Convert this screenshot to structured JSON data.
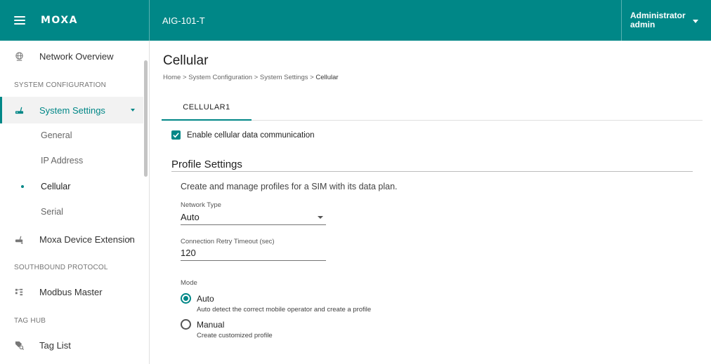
{
  "header": {
    "brand": "MOXA",
    "device_name": "AIG-101-T",
    "user_role": "Administrator",
    "user_name": "admin"
  },
  "sidebar": {
    "network_overview": "Network Overview",
    "section_system_config": "SYSTEM CONFIGURATION",
    "system_settings": "System Settings",
    "sub_items": [
      "General",
      "IP Address",
      "Cellular",
      "Serial"
    ],
    "moxa_device_extension": "Moxa Device Extension",
    "section_southbound": "SOUTHBOUND PROTOCOL",
    "modbus_master": "Modbus Master",
    "section_tag_hub": "TAG HUB",
    "tag_list": "Tag List"
  },
  "main": {
    "title": "Cellular",
    "breadcrumb": {
      "home": "Home",
      "sep": ">",
      "system_configuration": "System Configuration",
      "system_settings": "System Settings",
      "current": "Cellular"
    },
    "tabs": [
      {
        "label": "CELLULAR1"
      }
    ],
    "enable_label": "Enable cellular data communication",
    "enable_checked": true,
    "profile_settings_title": "Profile Settings",
    "profile_settings_desc": "Create and manage profiles for a SIM with its data plan.",
    "network_type": {
      "label": "Network Type",
      "value": "Auto"
    },
    "retry_timeout": {
      "label": "Connection Retry Timeout (sec)",
      "value": "120"
    },
    "mode": {
      "label": "Mode",
      "selected": "Auto",
      "options": [
        {
          "label": "Auto",
          "desc": "Auto detect the correct mobile operator and create a profile"
        },
        {
          "label": "Manual",
          "desc": "Create customized profile"
        }
      ]
    }
  },
  "colors": {
    "brand": "#008787",
    "header_text": "#ffffff",
    "active_bg": "#f2f2f2"
  }
}
